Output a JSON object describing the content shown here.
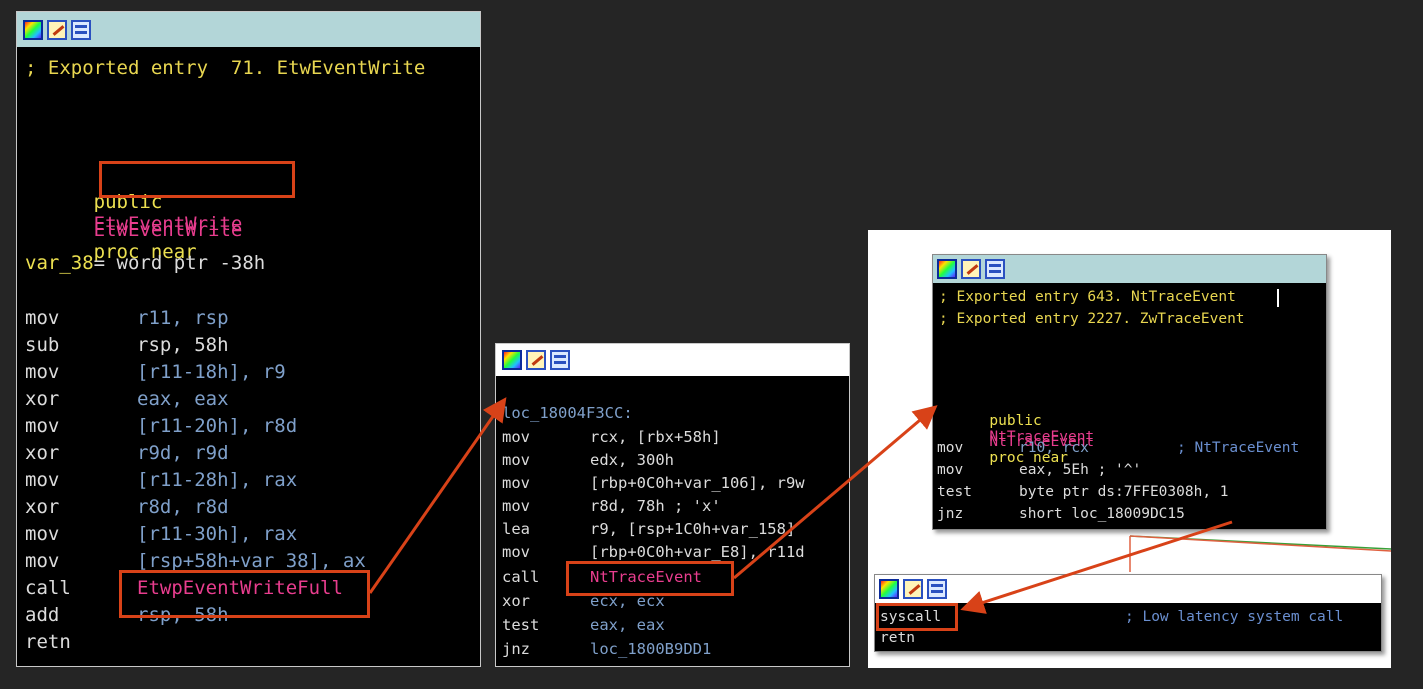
{
  "toolbar_icons": [
    "color-palette-icon",
    "edit-pencil-icon",
    "graph-view-icon"
  ],
  "win1": {
    "comment": "; Exported entry  71. EtwEventWrite",
    "public_kw": "public",
    "public_name": "EtwEventWrite",
    "proc_name": "EtwEventWrite",
    "proc_kw": "proc near",
    "var_name": "var_38",
    "var_rest": "= word ptr -38h",
    "rows": [
      {
        "op": "mov",
        "arg": "r11, rsp"
      },
      {
        "op": "sub",
        "arg": "rsp, 58h"
      },
      {
        "op": "mov",
        "arg": "[r11-18h], r9"
      },
      {
        "op": "xor",
        "arg": "eax, eax"
      },
      {
        "op": "mov",
        "arg": "[r11-20h], r8d"
      },
      {
        "op": "xor",
        "arg": "r9d, r9d"
      },
      {
        "op": "mov",
        "arg": "[r11-28h], rax"
      },
      {
        "op": "xor",
        "arg": "r8d, r8d"
      },
      {
        "op": "mov",
        "arg": "[r11-30h], rax"
      },
      {
        "op": "mov",
        "arg": "[rsp+58h+var_38], ax"
      },
      {
        "op": "call",
        "arg": "EtwpEventWriteFull"
      },
      {
        "op": "add",
        "arg": "rsp, 58h"
      },
      {
        "op": "retn",
        "arg": ""
      }
    ]
  },
  "win2": {
    "label": "loc_18004F3CC:",
    "rows": [
      {
        "op": "mov",
        "arg": "rcx, [rbx+58h]"
      },
      {
        "op": "mov",
        "arg": "edx, 300h"
      },
      {
        "op": "mov",
        "arg": "[rbp+0C0h+var_106], r9w"
      },
      {
        "op": "mov",
        "arg": "r8d, 78h ; 'x'"
      },
      {
        "op": "lea",
        "arg": "r9, [rsp+1C0h+var_158]"
      },
      {
        "op": "mov",
        "arg": "[rbp+0C0h+var_E8], r11d"
      },
      {
        "op": "call",
        "arg": "NtTraceEvent"
      },
      {
        "op": "xor",
        "arg": "ecx, ecx"
      },
      {
        "op": "test",
        "arg": "eax, eax"
      },
      {
        "op": "jnz",
        "arg": "loc_1800B9DD1"
      }
    ]
  },
  "win3": {
    "comment1": "; Exported entry 643. NtTraceEvent",
    "comment2": "; Exported entry 2227. ZwTraceEvent",
    "public_kw": "public",
    "public_name": "NtTraceEvent",
    "proc_name": "NtTraceEvent",
    "proc_kw": "proc near",
    "rows": [
      {
        "op": "mov",
        "arg": "r10, rcx",
        "cmt": "; NtTraceEvent"
      },
      {
        "op": "mov",
        "arg": "eax, 5Eh ; '^'",
        "cmt": ""
      },
      {
        "op": "test",
        "arg": "byte ptr ds:7FFE0308h, 1",
        "cmt": ""
      },
      {
        "op": "jnz",
        "arg": "short loc_18009DC15",
        "cmt": ""
      }
    ]
  },
  "win4": {
    "op1": "syscall",
    "cmt": "; Low latency system call",
    "op2": "retn"
  },
  "colors": {
    "background": "#252525",
    "highlight_box": "#d84218",
    "titlebar": "#b3d6d8",
    "comment": "#e8d650",
    "symbol": "#e83d8e",
    "operand": "#7fa0ca"
  }
}
